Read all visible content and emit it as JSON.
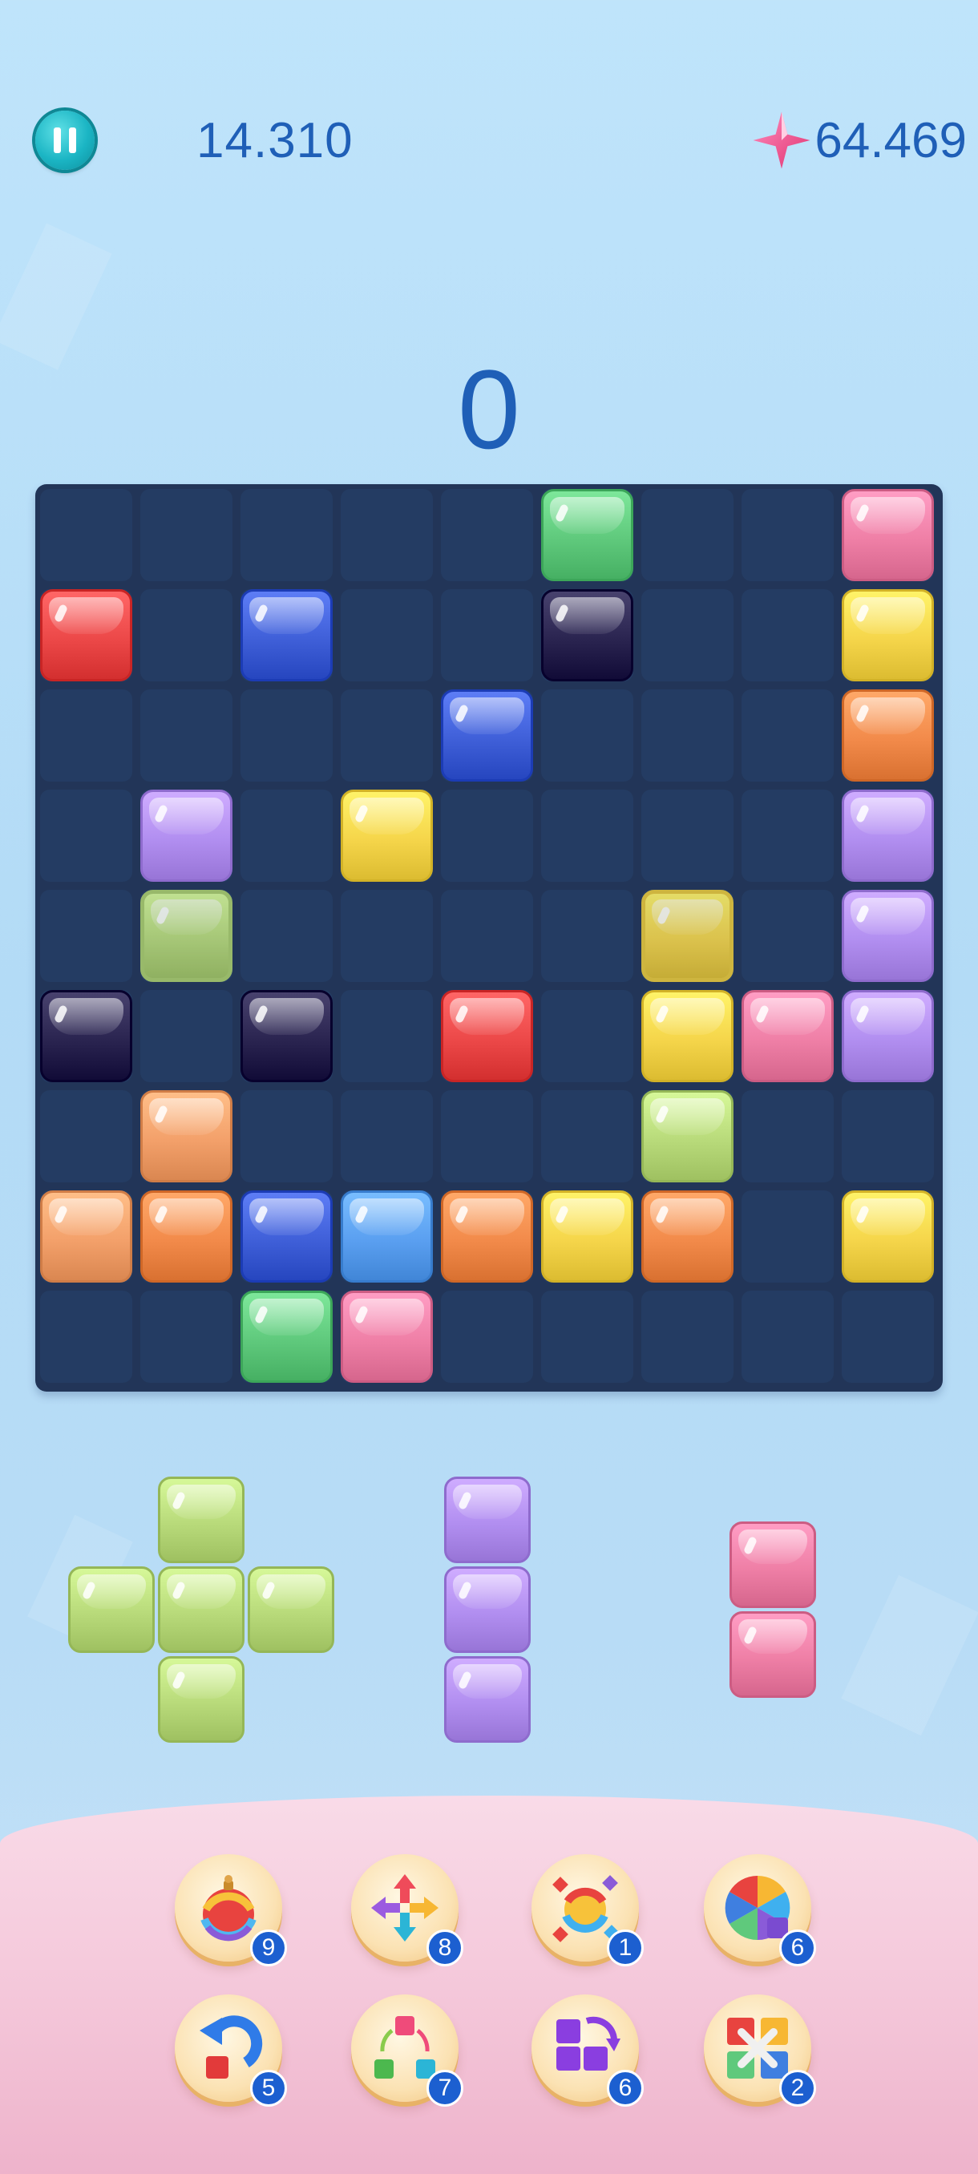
{
  "header": {
    "best_score": "14.310",
    "gem_count": "64.469",
    "current_score": "0"
  },
  "colors": {
    "green": "#5fc97c",
    "pink": "#ef7fa6",
    "red": "#ec4848",
    "blue": "#3f5fd8",
    "navy": "#2a2450",
    "yellow": "#f5d54a",
    "orange": "#f28a4a",
    "peach": "#f3a06a",
    "purple": "#b18ef0",
    "lime": "#b8da7a",
    "sky": "#5a9ff0",
    "empty_cell": "#243c63",
    "board": "#223558"
  },
  "board": {
    "cols": 9,
    "rows": 9,
    "cells": [
      [
        null,
        null,
        null,
        null,
        null,
        "green",
        null,
        null,
        "pink"
      ],
      [
        "red",
        null,
        "blue",
        null,
        null,
        "navy",
        null,
        null,
        "yellow"
      ],
      [
        null,
        null,
        null,
        null,
        "blue",
        null,
        null,
        null,
        "orange"
      ],
      [
        null,
        "purple",
        null,
        "yellow",
        null,
        null,
        null,
        null,
        "purple"
      ],
      [
        null,
        "lime-outline",
        null,
        null,
        null,
        null,
        "yellow-outline",
        null,
        "purple"
      ],
      [
        "navy",
        null,
        "navy",
        null,
        "red",
        null,
        "yellow",
        "pink",
        "purple"
      ],
      [
        null,
        "peach",
        null,
        null,
        null,
        null,
        "lime",
        null,
        null
      ],
      [
        "peach",
        "orange",
        "blue",
        "sky",
        "orange",
        "yellow",
        "orange",
        null,
        "yellow"
      ],
      [
        null,
        null,
        "green",
        "pink",
        null,
        null,
        null,
        null,
        null
      ]
    ]
  },
  "pieces": [
    {
      "name": "plus-piece",
      "color": "lime",
      "cells": [
        [
          0,
          1
        ],
        [
          1,
          0
        ],
        [
          1,
          1
        ],
        [
          1,
          2
        ],
        [
          2,
          1
        ]
      ]
    },
    {
      "name": "vertical-three-piece",
      "color": "purple",
      "cells": [
        [
          0,
          0
        ],
        [
          1,
          0
        ],
        [
          2,
          0
        ]
      ]
    },
    {
      "name": "vertical-two-piece",
      "color": "pink",
      "cells": [
        [
          0,
          0
        ],
        [
          1,
          0
        ]
      ]
    }
  ],
  "powerups": [
    {
      "name": "rainbow-bomb",
      "icon": "rainbow-bomb-icon",
      "count": "9"
    },
    {
      "name": "move",
      "icon": "four-arrows-icon",
      "count": "8"
    },
    {
      "name": "rainbow-blast",
      "icon": "rainbow-ball-icon",
      "count": "1"
    },
    {
      "name": "color-wheel",
      "icon": "color-wheel-icon",
      "count": "6"
    },
    {
      "name": "undo",
      "icon": "undo-arrow-icon",
      "count": "5"
    },
    {
      "name": "shuffle",
      "icon": "shuffle-blocks-icon",
      "count": "7"
    },
    {
      "name": "rotate",
      "icon": "rotate-piece-icon",
      "count": "6"
    },
    {
      "name": "clear",
      "icon": "clear-blocks-icon",
      "count": "2"
    }
  ]
}
